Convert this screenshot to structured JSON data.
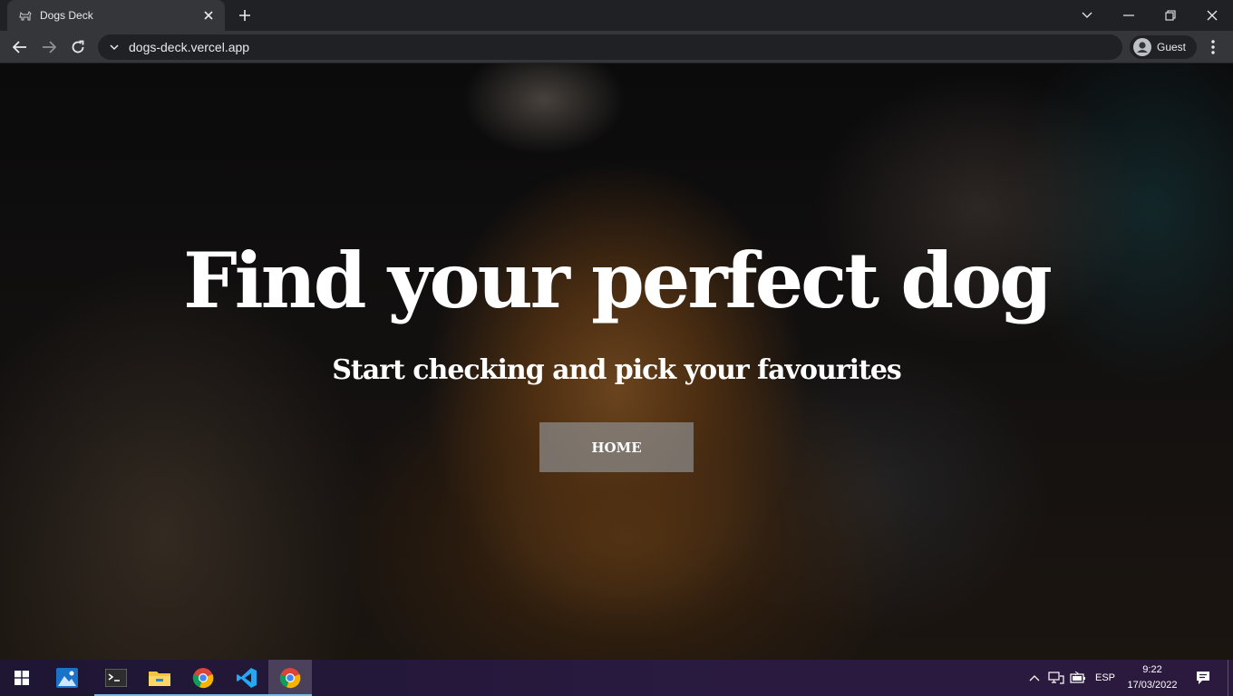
{
  "browser": {
    "tab_title": "Dogs Deck",
    "url": "dogs-deck.vercel.app",
    "profile_label": "Guest"
  },
  "hero": {
    "title": "Find your perfect dog",
    "subtitle": "Start checking and pick your favourites",
    "button_label": "HOME"
  },
  "taskbar": {
    "language": "ESP",
    "time": "9:22",
    "date": "17/03/2022",
    "apps": [
      "photos-icon",
      "terminal-icon",
      "file-explorer-icon",
      "chrome-icon",
      "vscode-icon",
      "chrome-icon"
    ]
  },
  "colors": {
    "chrome_dark": "#202124",
    "chrome_toolbar": "#35363a",
    "button_bg": "#8c8c8c",
    "taskbar_accent": "#76b9ed"
  }
}
